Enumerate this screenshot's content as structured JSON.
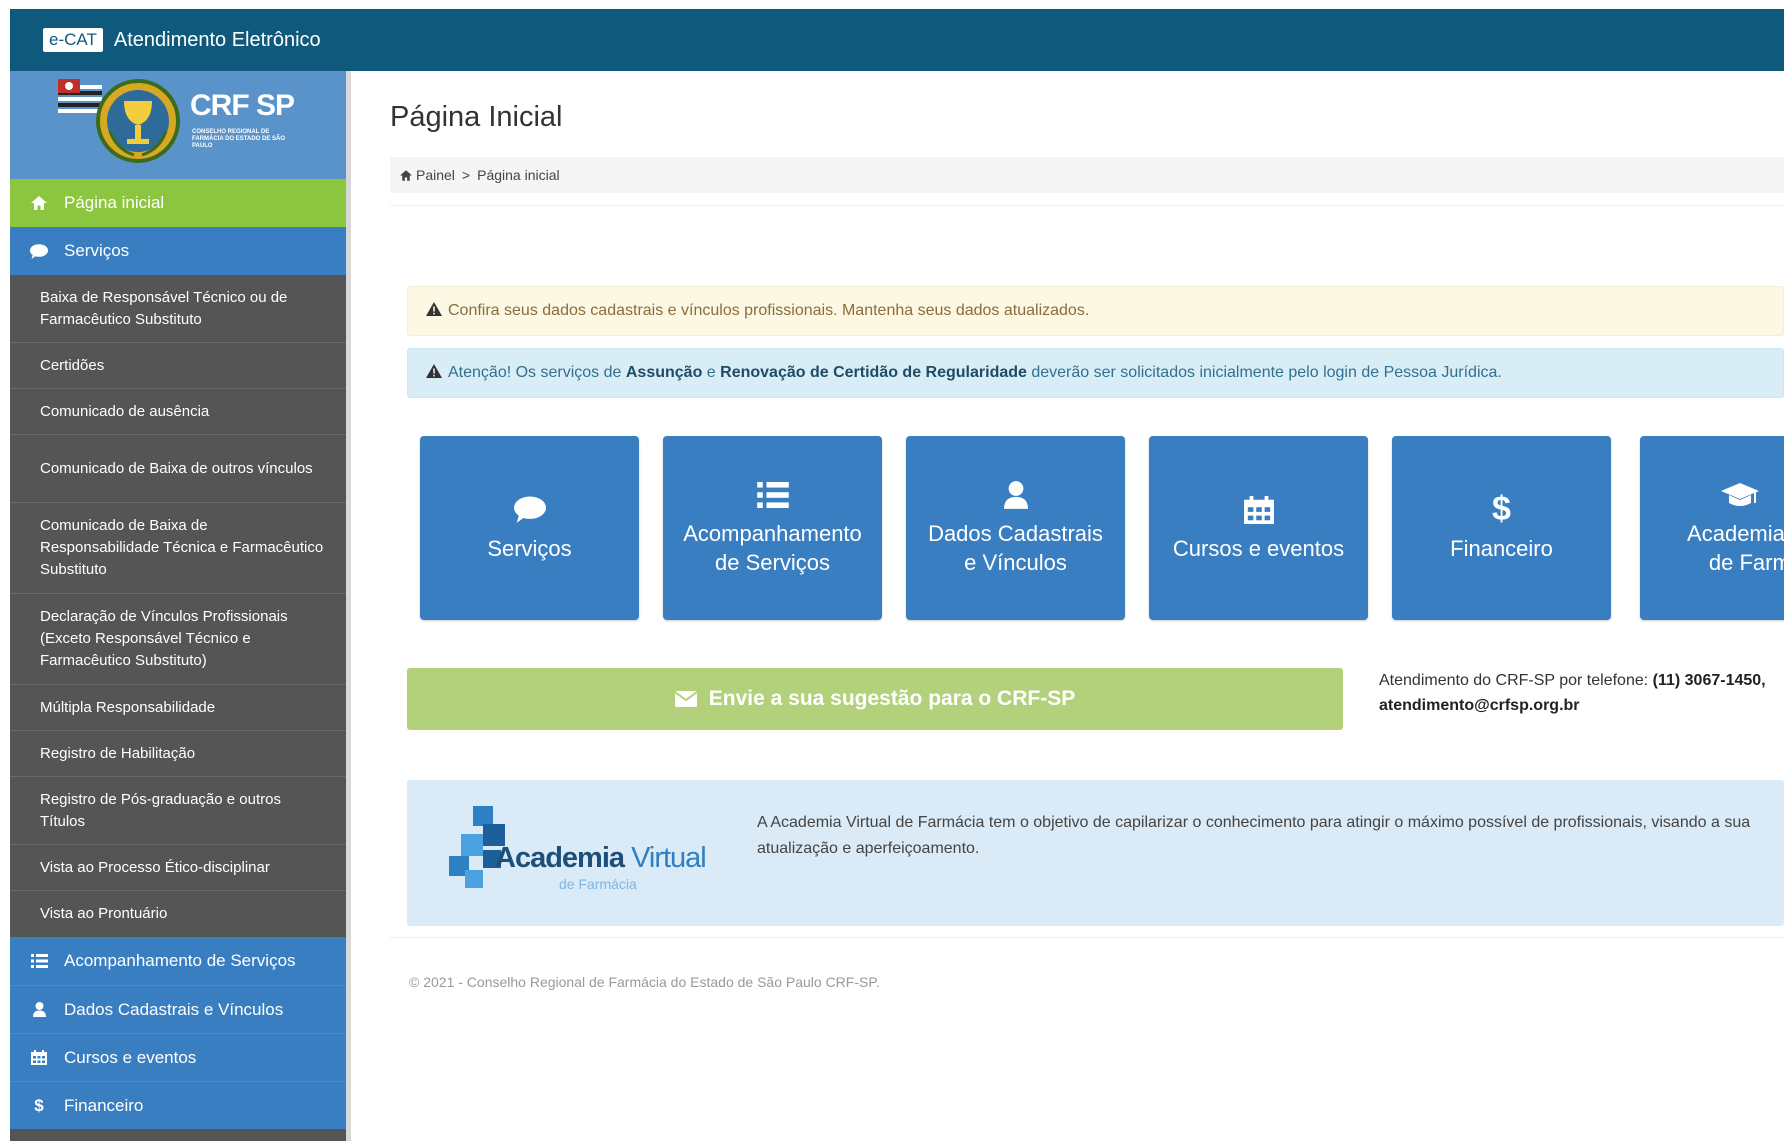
{
  "topbar": {
    "badge": "e-CAT",
    "title": "Atendimento Eletrônico"
  },
  "brand": {
    "logo_text": "CRF SP",
    "logo_sub": "CONSELHO REGIONAL DE FARMÁCIA DO ESTADO DE SÃO PAULO"
  },
  "sidebar": {
    "home": "Página inicial",
    "services": "Serviços",
    "sub_items": [
      "Baixa de Responsável Técnico ou de Farmacêutico Substituto",
      "Certidões",
      "Comunicado de ausência",
      "Comunicado de Baixa de outros vínculos",
      "Comunicado de Baixa de Responsabilidade Técnica e Farmacêutico Substituto",
      "Declaração de Vínculos Profissionais (Exceto Responsável Técnico e Farmacêutico Substituto)",
      "Múltipla Responsabilidade",
      "Registro de Habilitação",
      "Registro de Pós-graduação e outros Títulos",
      "Vista ao Processo Ético-disciplinar",
      "Vista ao Prontuário"
    ],
    "bottom_items": [
      {
        "label": "Acompanhamento de Serviços",
        "icon": "list-icon"
      },
      {
        "label": "Dados Cadastrais e Vínculos",
        "icon": "user-icon"
      },
      {
        "label": "Cursos e eventos",
        "icon": "calendar-icon"
      },
      {
        "label": "Financeiro",
        "icon": "dollar-icon"
      }
    ]
  },
  "main": {
    "page_title": "Página Inicial",
    "breadcrumb": {
      "root": "Painel",
      "separator": ">",
      "current": "Página inicial"
    },
    "alert_warning": "Confira seus dados cadastrais e vínculos profissionais. Mantenha seus dados atualizados.",
    "alert_info": {
      "prefix": "Atenção! Os serviços de",
      "bold1": "Assunção",
      "mid": "e",
      "bold2": "Renovação de Certidão de Regularidade",
      "suffix": "deverão ser solicitados inicialmente pelo login de Pessoa Jurídica."
    },
    "tiles": [
      {
        "label": "Serviços",
        "icon": "chat-icon"
      },
      {
        "label": "Acompanhamento de Serviços",
        "icon": "list-icon"
      },
      {
        "label": "Dados Cadastrais e Vínculos",
        "icon": "user-icon"
      },
      {
        "label": "Cursos e eventos",
        "icon": "calendar-icon"
      },
      {
        "label": "Financeiro",
        "icon": "dollar-icon"
      },
      {
        "label": "Academia Virtual de Farmácia",
        "icon": "graduation-cap-icon"
      }
    ],
    "suggest_button": "Envie a sua sugestão para o CRF-SP",
    "phone": {
      "text": "Atendimento do CRF-SP por telefone:",
      "number": "(11) 3067-1450,",
      "email": "atendimento@crfsp.org.br"
    },
    "academy": {
      "logo_main1": "Academia",
      "logo_main2": "Virtual",
      "logo_sub": "de Farmácia",
      "description": "A Academia Virtual de Farmácia tem o objetivo de capilarizar o conhecimento para atingir o máximo possível de profissionais, visando a sua atualização e aperfeiçoamento."
    },
    "footer": "© 2021 - Conselho Regional de Farmácia do Estado de São Paulo CRF-SP."
  },
  "colors": {
    "topbar": "#0f5a7c",
    "sidebar": "#555555",
    "nav_home": "#8cc63f",
    "primary_blue": "#3a7ec2",
    "suggest_green": "#b3d17a",
    "warning_bg": "#fcf8e3",
    "info_bg": "#d9edf7",
    "academy_bg": "#daeaf6"
  }
}
